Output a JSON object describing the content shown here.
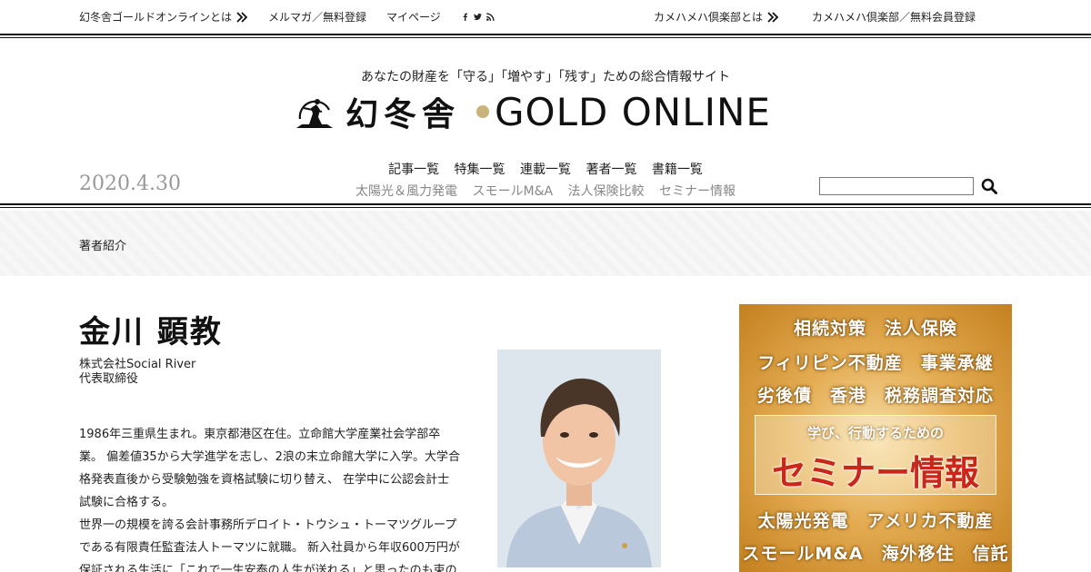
{
  "topbar": {
    "about": "幻冬舎ゴールドオンラインとは",
    "mailmag": "メルマガ／無料登録",
    "mypage": "マイページ",
    "social_icons": [
      "facebook-icon",
      "twitter-icon",
      "rss-icon"
    ],
    "kamehameha_about": "カメハメハ倶楽部とは",
    "kamehameha_register": "カメハメハ倶楽部／無料会員登録"
  },
  "header": {
    "tagline": "あなたの財産を「守る」「増やす」「残す」ための総合情報サイト",
    "logo_kanji": "幻冬舎",
    "logo_text": "GOLD ONLINE",
    "date": "2020.4.30"
  },
  "nav": {
    "primary": [
      "記事一覧",
      "特集一覧",
      "連載一覧",
      "著者一覧",
      "書籍一覧"
    ],
    "secondary": [
      "太陽光＆風力発電",
      "スモールM&A",
      "法人保険比較",
      "セミナー情報"
    ]
  },
  "search": {
    "placeholder": ""
  },
  "breadcrumb": "著者紹介",
  "author": {
    "name": "金川 顕教",
    "company": "株式会社Social River",
    "title": "代表取締役",
    "bio_lines": [
      "1986年三重県生まれ。東京都港区在住。立命館大学産業社会学部卒",
      "業。 偏差値35から大学進学を志し、2浪の末立命館大学に入学。大学合",
      "格発表直後から受験勉強を資格試験に切り替え、 在学中に公認会計士",
      "試験に合格する。",
      "世界一の規模を誇る会計事務所デロイト・トウシュ・トーマツグループ",
      "である有限責任監査法人トーマツに就職。 新入社員から年収600万円が",
      "保証される生活に「これで一生安泰の人生が送れる」と思ったのも束の"
    ]
  },
  "ad": {
    "row1": "相続対策　法人保険",
    "row2": "フィリピン不動産　事業承継",
    "row3": "劣後債　香港　税務調査対応",
    "sub": "学び、行動するための",
    "big": "セミナー情報",
    "row4": "太陽光発電　アメリカ不動産",
    "row5": "スモールM&A　海外移住　信託"
  },
  "colors": {
    "accent_gold": "#c9b37a",
    "ad_red": "#c8271a",
    "muted": "#999999"
  }
}
